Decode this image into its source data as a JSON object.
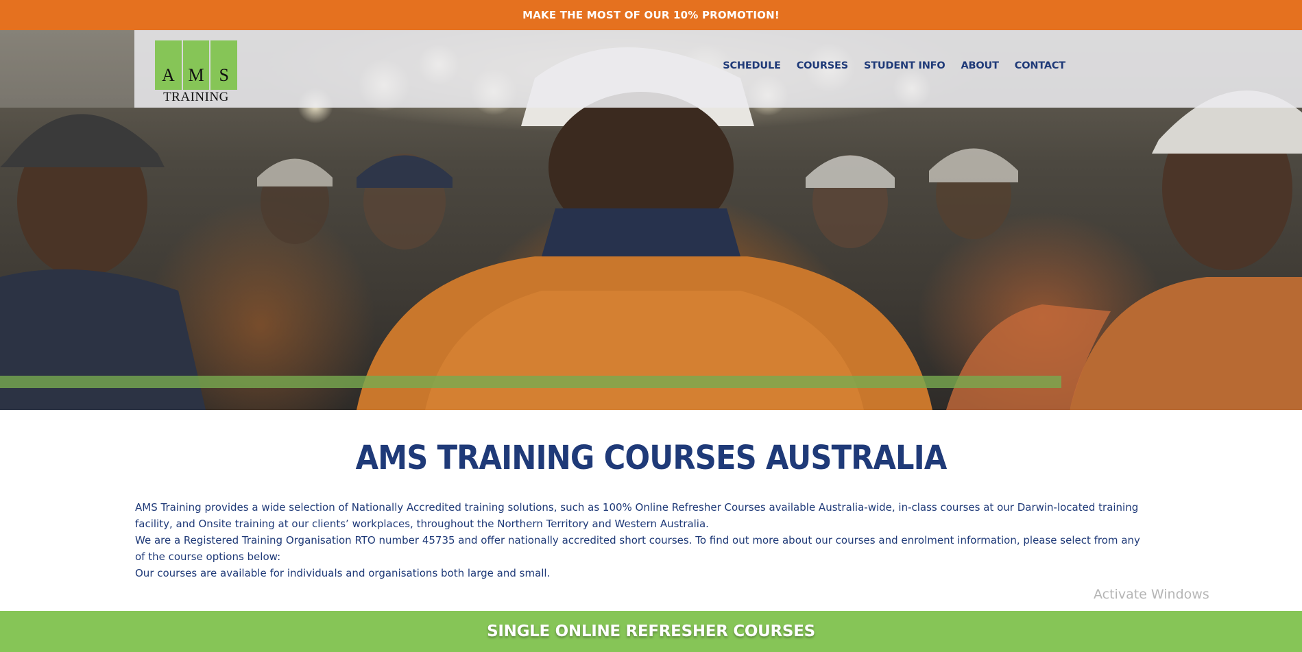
{
  "promo": {
    "text": "MAKE THE MOST OF OUR 10% PROMOTION!"
  },
  "logo": {
    "letters": [
      "A",
      "M",
      "S"
    ],
    "subtitle": "TRAINING"
  },
  "nav": {
    "items": [
      {
        "label": "SCHEDULE"
      },
      {
        "label": "COURSES"
      },
      {
        "label": "STUDENT INFO"
      },
      {
        "label": "ABOUT"
      },
      {
        "label": "CONTACT"
      }
    ]
  },
  "main": {
    "title": "AMS TRAINING COURSES  AUSTRALIA",
    "paragraphs": [
      "AMS Training provides a wide selection of Nationally Accredited training solutions, such as 100% Online Refresher Courses available Australia-wide, in-class courses at our Darwin-located training facility, and Onsite training at our clients’ workplaces, throughout the Northern Territory and Western Australia.",
      "We are a Registered Training Organisation RTO number 45735 and offer nationally accredited short courses. To find out more about our courses and enrolment information, please select from any of the course options below:",
      "Our courses are available for individuals and organisations both large and small."
    ]
  },
  "section": {
    "heading": "SINGLE ONLINE REFRESHER COURSES"
  },
  "system": {
    "watermark": "Activate Windows"
  },
  "colors": {
    "accent_orange": "#e5711f",
    "brand_green": "#86c557",
    "navy": "#1f3a78"
  }
}
